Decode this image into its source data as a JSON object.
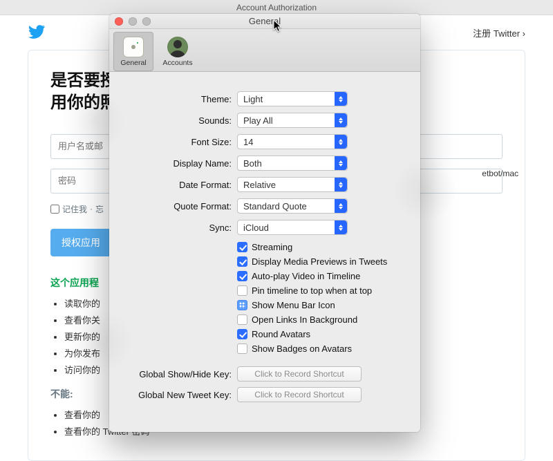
{
  "background": {
    "window_title": "Account Authorization",
    "register_link": "注册 Twitter ›",
    "heading_line1": "是否要授",
    "heading_line2": "用你的照",
    "placeholder_user": "用户名或邮",
    "placeholder_pass": "密码",
    "remember_label": "记住我",
    "forgot_label": "忘",
    "authorize_button": "授权应用",
    "section_ok_title": "这个应用程",
    "ok_items": [
      "读取你的",
      "查看你关",
      "更新你的",
      "为你发布",
      "访问你的"
    ],
    "section_bad_title": "不能:",
    "bad_items": [
      "查看你的",
      "查看你的 Twitter 密码"
    ],
    "side_text": "etbot/mac"
  },
  "pref": {
    "title": "General",
    "tabs": {
      "general": "General",
      "accounts": "Accounts"
    },
    "labels": {
      "theme": "Theme:",
      "sounds": "Sounds:",
      "font_size": "Font Size:",
      "display_name": "Display Name:",
      "date_format": "Date Format:",
      "quote_format": "Quote Format:",
      "sync": "Sync:",
      "global_showhide": "Global Show/Hide Key:",
      "global_newtweet": "Global New Tweet Key:"
    },
    "values": {
      "theme": "Light",
      "sounds": "Play All",
      "font_size": "14",
      "display_name": "Both",
      "date_format": "Relative",
      "quote_format": "Standard Quote",
      "sync": "iCloud"
    },
    "checks": [
      {
        "label": "Streaming",
        "on": true
      },
      {
        "label": "Display Media Previews in Tweets",
        "on": true
      },
      {
        "label": "Auto-play Video in Timeline",
        "on": true
      },
      {
        "label": "Pin timeline to top when at top",
        "on": false
      },
      {
        "label": "Show Menu Bar Icon",
        "mixed": true
      },
      {
        "label": "Open Links In Background",
        "on": false
      },
      {
        "label": "Round Avatars",
        "on": true
      },
      {
        "label": "Show Badges on Avatars",
        "on": false
      }
    ],
    "shortcut_placeholder": "Click to Record Shortcut"
  }
}
